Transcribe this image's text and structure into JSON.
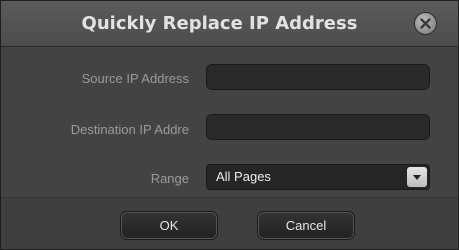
{
  "dialog": {
    "title": "Quickly Replace IP Address",
    "close_icon": "close-icon"
  },
  "form": {
    "source_label": "Source IP Address",
    "source_value": "",
    "destination_label": "Destination IP Addre",
    "destination_value": "",
    "range_label": "Range",
    "range_selected": "All Pages",
    "range_arrow_icon": "chevron-down-icon"
  },
  "buttons": {
    "ok_label": "OK",
    "cancel_label": "Cancel"
  },
  "colors": {
    "background": "#434343",
    "titlebar": "#535353",
    "field": "#2a2a2a",
    "text": "#e2e2e2",
    "label": "#9a9a9a"
  }
}
